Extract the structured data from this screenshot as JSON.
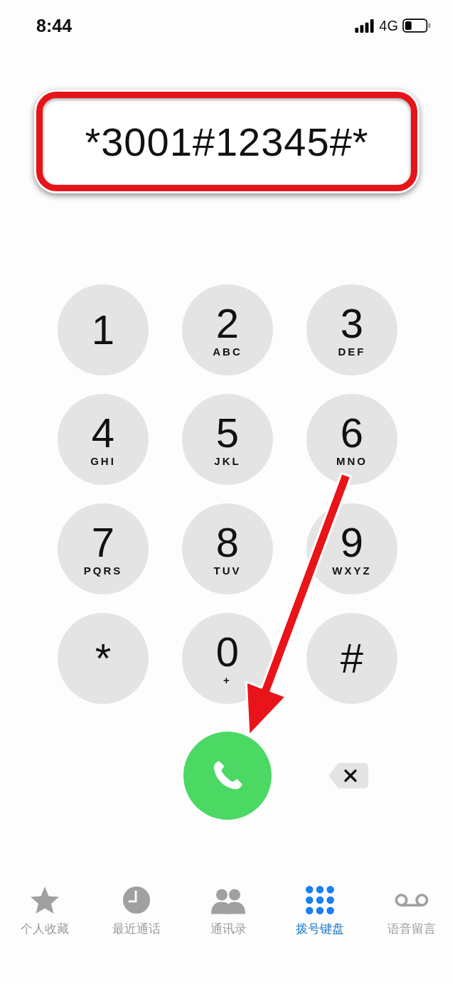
{
  "status_bar": {
    "time": "8:44",
    "network": "4G"
  },
  "dialed_number": "*3001#12345#*",
  "keypad": [
    {
      "digit": "1"
    },
    {
      "digit": "2",
      "letters": "ABC"
    },
    {
      "digit": "3",
      "letters": "DEF"
    },
    {
      "digit": "4",
      "letters": "GHI"
    },
    {
      "digit": "5",
      "letters": "JKL"
    },
    {
      "digit": "6",
      "letters": "MNO"
    },
    {
      "digit": "7",
      "letters": "PQRS"
    },
    {
      "digit": "8",
      "letters": "TUV"
    },
    {
      "digit": "9",
      "letters": "WXYZ"
    },
    {
      "digit": "*"
    },
    {
      "digit": "0",
      "letters": "+"
    },
    {
      "digit": "#"
    }
  ],
  "tabs": [
    {
      "label": "个人收藏",
      "selected": false
    },
    {
      "label": "最近通话",
      "selected": false
    },
    {
      "label": "通讯录",
      "selected": false
    },
    {
      "label": "拨号键盘",
      "selected": true
    },
    {
      "label": "语音留言",
      "selected": false
    }
  ]
}
